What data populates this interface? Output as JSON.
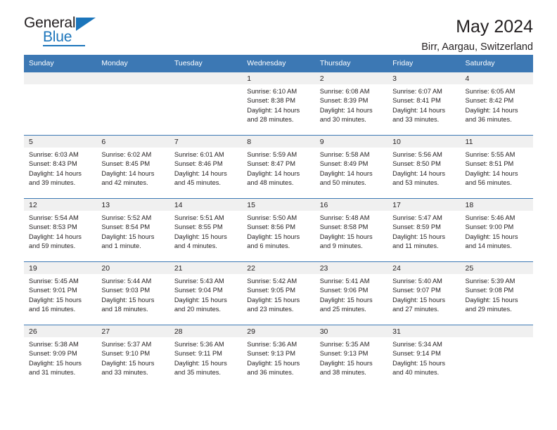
{
  "logo": {
    "word_top": "General",
    "word_bottom": "Blue",
    "accent_color": "#1b75bb",
    "triangle_icon": "triangle-icon"
  },
  "header": {
    "title": "May 2024",
    "subtitle": "Birr, Aargau, Switzerland"
  },
  "calendar": {
    "header_bg": "#3c78b4",
    "daycell_strip_bg": "#f0f0f0",
    "weekday_headers": [
      "Sunday",
      "Monday",
      "Tuesday",
      "Wednesday",
      "Thursday",
      "Friday",
      "Saturday"
    ],
    "labels": {
      "sunrise": "Sunrise:",
      "sunset": "Sunset:",
      "daylight": "Daylight:"
    },
    "weeks": [
      [
        {
          "day": "",
          "empty": true
        },
        {
          "day": "",
          "empty": true
        },
        {
          "day": "",
          "empty": true
        },
        {
          "day": "1",
          "sunrise": "Sunrise: 6:10 AM",
          "sunset": "Sunset: 8:38 PM",
          "daylight_line1": "Daylight: 14 hours",
          "daylight_line2": "and 28 minutes."
        },
        {
          "day": "2",
          "sunrise": "Sunrise: 6:08 AM",
          "sunset": "Sunset: 8:39 PM",
          "daylight_line1": "Daylight: 14 hours",
          "daylight_line2": "and 30 minutes."
        },
        {
          "day": "3",
          "sunrise": "Sunrise: 6:07 AM",
          "sunset": "Sunset: 8:41 PM",
          "daylight_line1": "Daylight: 14 hours",
          "daylight_line2": "and 33 minutes."
        },
        {
          "day": "4",
          "sunrise": "Sunrise: 6:05 AM",
          "sunset": "Sunset: 8:42 PM",
          "daylight_line1": "Daylight: 14 hours",
          "daylight_line2": "and 36 minutes."
        }
      ],
      [
        {
          "day": "5",
          "sunrise": "Sunrise: 6:03 AM",
          "sunset": "Sunset: 8:43 PM",
          "daylight_line1": "Daylight: 14 hours",
          "daylight_line2": "and 39 minutes."
        },
        {
          "day": "6",
          "sunrise": "Sunrise: 6:02 AM",
          "sunset": "Sunset: 8:45 PM",
          "daylight_line1": "Daylight: 14 hours",
          "daylight_line2": "and 42 minutes."
        },
        {
          "day": "7",
          "sunrise": "Sunrise: 6:01 AM",
          "sunset": "Sunset: 8:46 PM",
          "daylight_line1": "Daylight: 14 hours",
          "daylight_line2": "and 45 minutes."
        },
        {
          "day": "8",
          "sunrise": "Sunrise: 5:59 AM",
          "sunset": "Sunset: 8:47 PM",
          "daylight_line1": "Daylight: 14 hours",
          "daylight_line2": "and 48 minutes."
        },
        {
          "day": "9",
          "sunrise": "Sunrise: 5:58 AM",
          "sunset": "Sunset: 8:49 PM",
          "daylight_line1": "Daylight: 14 hours",
          "daylight_line2": "and 50 minutes."
        },
        {
          "day": "10",
          "sunrise": "Sunrise: 5:56 AM",
          "sunset": "Sunset: 8:50 PM",
          "daylight_line1": "Daylight: 14 hours",
          "daylight_line2": "and 53 minutes."
        },
        {
          "day": "11",
          "sunrise": "Sunrise: 5:55 AM",
          "sunset": "Sunset: 8:51 PM",
          "daylight_line1": "Daylight: 14 hours",
          "daylight_line2": "and 56 minutes."
        }
      ],
      [
        {
          "day": "12",
          "sunrise": "Sunrise: 5:54 AM",
          "sunset": "Sunset: 8:53 PM",
          "daylight_line1": "Daylight: 14 hours",
          "daylight_line2": "and 59 minutes."
        },
        {
          "day": "13",
          "sunrise": "Sunrise: 5:52 AM",
          "sunset": "Sunset: 8:54 PM",
          "daylight_line1": "Daylight: 15 hours",
          "daylight_line2": "and 1 minute."
        },
        {
          "day": "14",
          "sunrise": "Sunrise: 5:51 AM",
          "sunset": "Sunset: 8:55 PM",
          "daylight_line1": "Daylight: 15 hours",
          "daylight_line2": "and 4 minutes."
        },
        {
          "day": "15",
          "sunrise": "Sunrise: 5:50 AM",
          "sunset": "Sunset: 8:56 PM",
          "daylight_line1": "Daylight: 15 hours",
          "daylight_line2": "and 6 minutes."
        },
        {
          "day": "16",
          "sunrise": "Sunrise: 5:48 AM",
          "sunset": "Sunset: 8:58 PM",
          "daylight_line1": "Daylight: 15 hours",
          "daylight_line2": "and 9 minutes."
        },
        {
          "day": "17",
          "sunrise": "Sunrise: 5:47 AM",
          "sunset": "Sunset: 8:59 PM",
          "daylight_line1": "Daylight: 15 hours",
          "daylight_line2": "and 11 minutes."
        },
        {
          "day": "18",
          "sunrise": "Sunrise: 5:46 AM",
          "sunset": "Sunset: 9:00 PM",
          "daylight_line1": "Daylight: 15 hours",
          "daylight_line2": "and 14 minutes."
        }
      ],
      [
        {
          "day": "19",
          "sunrise": "Sunrise: 5:45 AM",
          "sunset": "Sunset: 9:01 PM",
          "daylight_line1": "Daylight: 15 hours",
          "daylight_line2": "and 16 minutes."
        },
        {
          "day": "20",
          "sunrise": "Sunrise: 5:44 AM",
          "sunset": "Sunset: 9:03 PM",
          "daylight_line1": "Daylight: 15 hours",
          "daylight_line2": "and 18 minutes."
        },
        {
          "day": "21",
          "sunrise": "Sunrise: 5:43 AM",
          "sunset": "Sunset: 9:04 PM",
          "daylight_line1": "Daylight: 15 hours",
          "daylight_line2": "and 20 minutes."
        },
        {
          "day": "22",
          "sunrise": "Sunrise: 5:42 AM",
          "sunset": "Sunset: 9:05 PM",
          "daylight_line1": "Daylight: 15 hours",
          "daylight_line2": "and 23 minutes."
        },
        {
          "day": "23",
          "sunrise": "Sunrise: 5:41 AM",
          "sunset": "Sunset: 9:06 PM",
          "daylight_line1": "Daylight: 15 hours",
          "daylight_line2": "and 25 minutes."
        },
        {
          "day": "24",
          "sunrise": "Sunrise: 5:40 AM",
          "sunset": "Sunset: 9:07 PM",
          "daylight_line1": "Daylight: 15 hours",
          "daylight_line2": "and 27 minutes."
        },
        {
          "day": "25",
          "sunrise": "Sunrise: 5:39 AM",
          "sunset": "Sunset: 9:08 PM",
          "daylight_line1": "Daylight: 15 hours",
          "daylight_line2": "and 29 minutes."
        }
      ],
      [
        {
          "day": "26",
          "sunrise": "Sunrise: 5:38 AM",
          "sunset": "Sunset: 9:09 PM",
          "daylight_line1": "Daylight: 15 hours",
          "daylight_line2": "and 31 minutes."
        },
        {
          "day": "27",
          "sunrise": "Sunrise: 5:37 AM",
          "sunset": "Sunset: 9:10 PM",
          "daylight_line1": "Daylight: 15 hours",
          "daylight_line2": "and 33 minutes."
        },
        {
          "day": "28",
          "sunrise": "Sunrise: 5:36 AM",
          "sunset": "Sunset: 9:11 PM",
          "daylight_line1": "Daylight: 15 hours",
          "daylight_line2": "and 35 minutes."
        },
        {
          "day": "29",
          "sunrise": "Sunrise: 5:36 AM",
          "sunset": "Sunset: 9:13 PM",
          "daylight_line1": "Daylight: 15 hours",
          "daylight_line2": "and 36 minutes."
        },
        {
          "day": "30",
          "sunrise": "Sunrise: 5:35 AM",
          "sunset": "Sunset: 9:13 PM",
          "daylight_line1": "Daylight: 15 hours",
          "daylight_line2": "and 38 minutes."
        },
        {
          "day": "31",
          "sunrise": "Sunrise: 5:34 AM",
          "sunset": "Sunset: 9:14 PM",
          "daylight_line1": "Daylight: 15 hours",
          "daylight_line2": "and 40 minutes."
        },
        {
          "day": "",
          "empty": true
        }
      ]
    ]
  }
}
